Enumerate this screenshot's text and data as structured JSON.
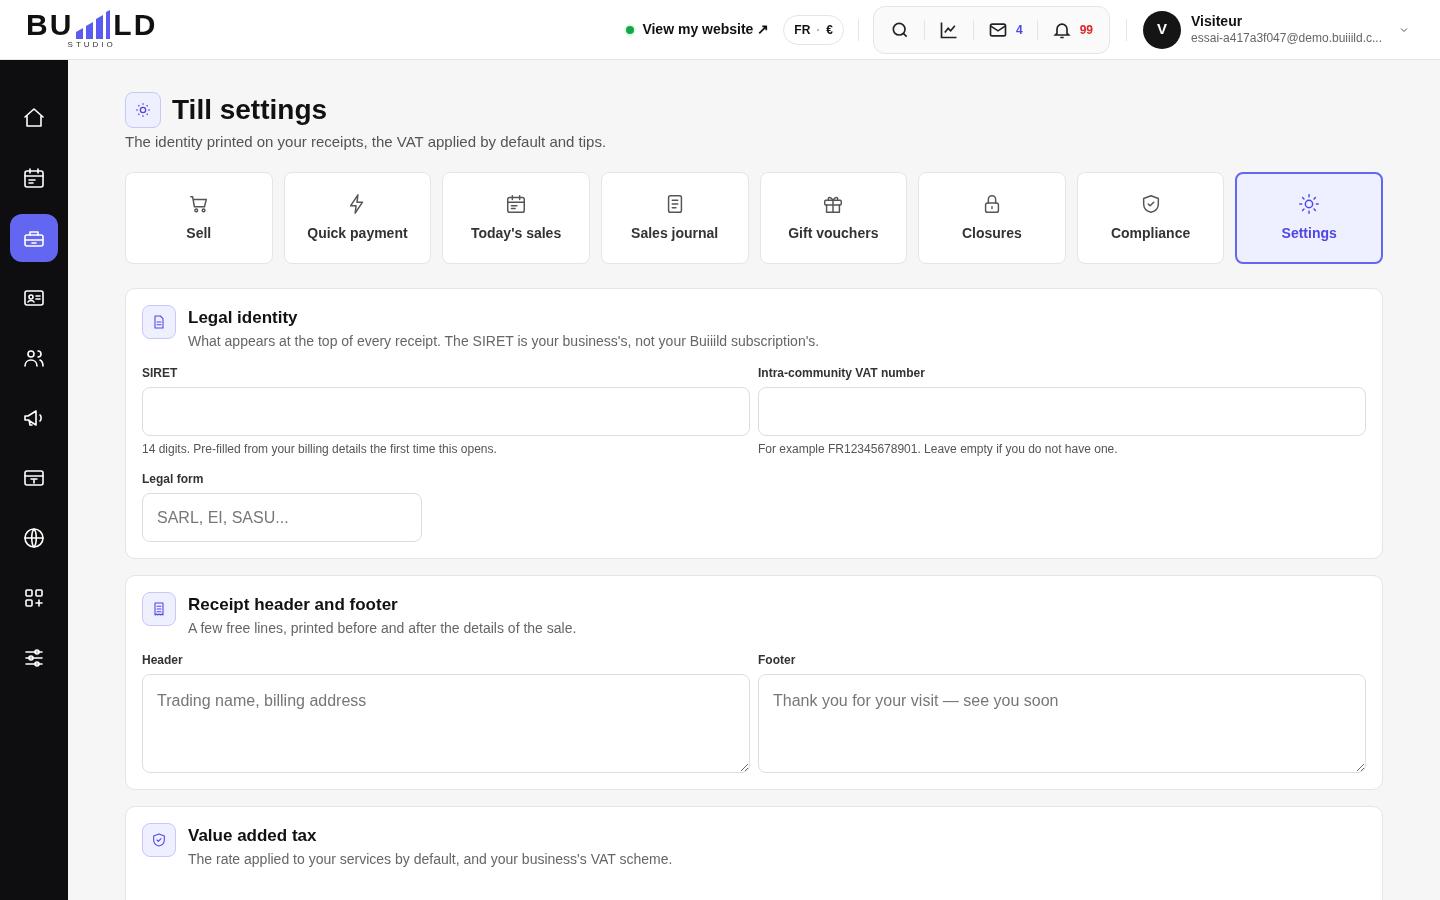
{
  "logo": {
    "left": "BU",
    "right": "LD",
    "sub": "STUDIO"
  },
  "topbar": {
    "website_link": "View my website ↗",
    "locale": {
      "language": "FR",
      "separator": "·",
      "currency": "€"
    },
    "messages_count": "4",
    "notifications_count": "99",
    "user": {
      "initial": "V",
      "name": "Visiteur",
      "email": "essai-a417a3f047@demo.buiiild.c..."
    }
  },
  "sidebar": {
    "items": [
      {
        "kind": "home",
        "selected": false
      },
      {
        "kind": "calendar",
        "selected": false
      },
      {
        "kind": "register",
        "selected": true
      },
      {
        "kind": "id-card",
        "selected": false
      },
      {
        "kind": "users",
        "selected": false
      },
      {
        "kind": "megaphone",
        "selected": false
      },
      {
        "kind": "card",
        "selected": false
      },
      {
        "kind": "globe",
        "selected": false
      },
      {
        "kind": "apps",
        "selected": false
      },
      {
        "kind": "sliders",
        "selected": false
      }
    ]
  },
  "page": {
    "title": "Till settings",
    "subtitle": "The identity printed on your receipts, the VAT applied by default and tips."
  },
  "tabs": [
    {
      "label": "Sell",
      "kind": "cart",
      "selected": false
    },
    {
      "label": "Quick payment",
      "kind": "bolt",
      "selected": false
    },
    {
      "label": "Today's sales",
      "kind": "calendar",
      "selected": false
    },
    {
      "label": "Sales journal",
      "kind": "document",
      "selected": false
    },
    {
      "label": "Gift vouchers",
      "kind": "gift",
      "selected": false
    },
    {
      "label": "Closures",
      "kind": "lock",
      "selected": false
    },
    {
      "label": "Compliance",
      "kind": "shield",
      "selected": false
    },
    {
      "label": "Settings",
      "kind": "sun",
      "selected": true
    }
  ],
  "sections": [
    {
      "kind": "file",
      "title": "Legal identity",
      "description": "What appears at the top of every receipt. The SIRET is your business's, not your Buiiild subscription's.",
      "fields": [
        {
          "kind": "text",
          "label": "SIRET",
          "hint": "14 digits. Pre-filled from your billing details the first time this opens."
        },
        {
          "kind": "text",
          "label": "Intra-community VAT number",
          "hint": "For example FR12345678901. Leave empty if you do not have one."
        },
        {
          "kind": "short_text",
          "label": "Legal form",
          "placeholder": "SARL, EI, SASU..."
        }
      ]
    },
    {
      "kind": "receipt",
      "title": "Receipt header and footer",
      "description": "A few free lines, printed before and after the details of the sale.",
      "fields": [
        {
          "kind": "textarea",
          "label": "Header",
          "placeholder": "Trading name, billing address"
        },
        {
          "kind": "textarea",
          "label": "Footer",
          "placeholder": "Thank you for your visit — see you soon"
        }
      ]
    },
    {
      "kind": "shield",
      "title": "Value added tax",
      "description": "The rate applied to your services by default, and your business's VAT scheme."
    }
  ]
}
